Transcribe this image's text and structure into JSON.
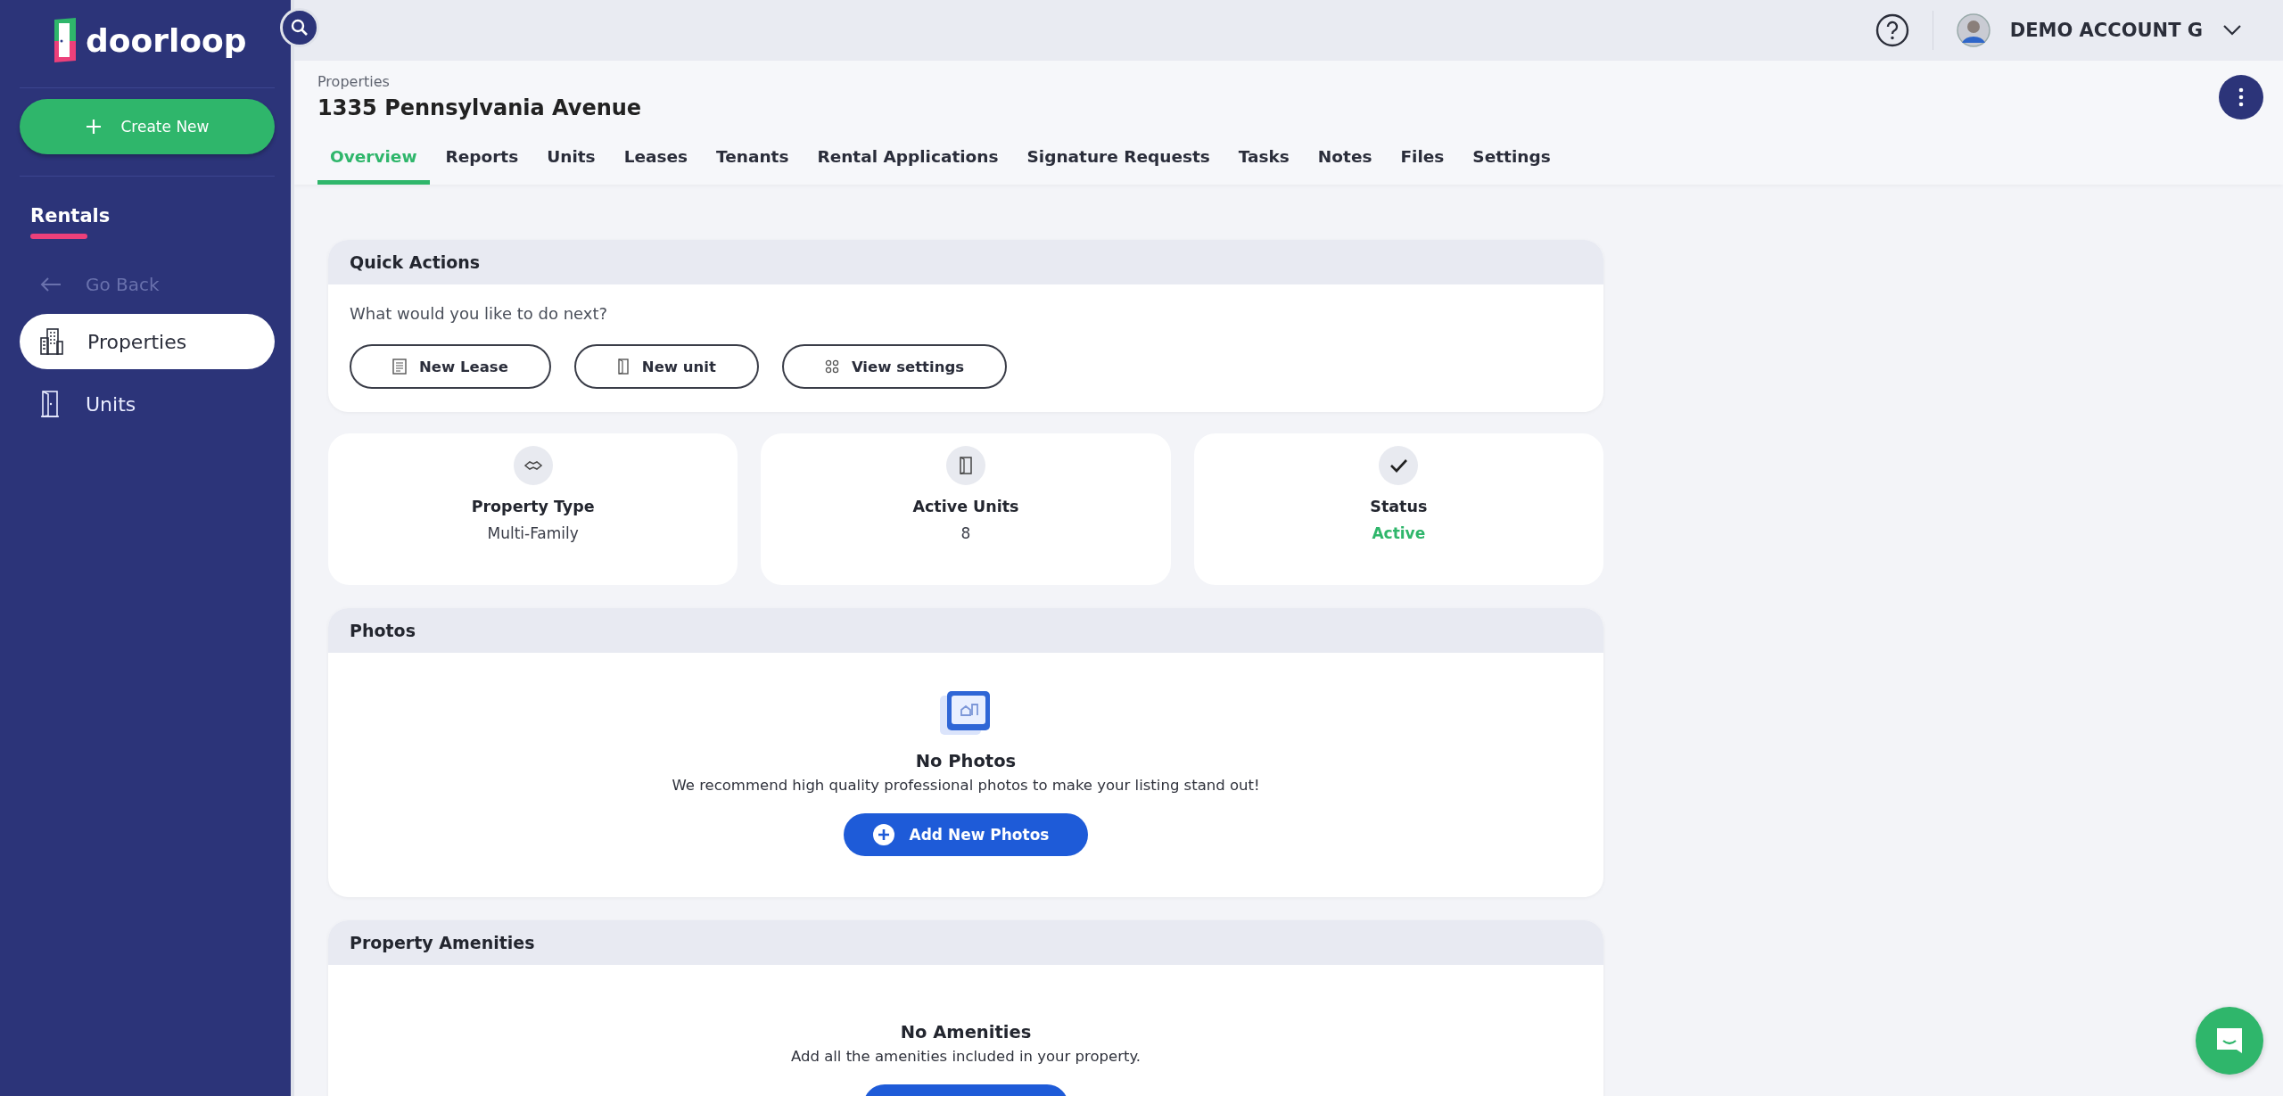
{
  "sidebar": {
    "logo": "doorloop",
    "create_button": "Create New",
    "section_title": "Rentals",
    "items": [
      {
        "label": "Go Back",
        "kind": "back",
        "selected": false,
        "disabled": true
      },
      {
        "label": "Properties",
        "kind": "properties",
        "selected": true,
        "disabled": false
      },
      {
        "label": "Units",
        "kind": "units",
        "selected": false,
        "disabled": false
      }
    ]
  },
  "topbar": {
    "account_name": "DEMO ACCOUNT G"
  },
  "header": {
    "breadcrumb": "Properties",
    "title": "1335 Pennsylvania Avenue",
    "tabs": [
      {
        "label": "Overview",
        "selected": true
      },
      {
        "label": "Reports",
        "selected": false
      },
      {
        "label": "Units",
        "selected": false
      },
      {
        "label": "Leases",
        "selected": false
      },
      {
        "label": "Tenants",
        "selected": false
      },
      {
        "label": "Rental Applications",
        "selected": false
      },
      {
        "label": "Signature Requests",
        "selected": false
      },
      {
        "label": "Tasks",
        "selected": false
      },
      {
        "label": "Notes",
        "selected": false
      },
      {
        "label": "Files",
        "selected": false
      },
      {
        "label": "Settings",
        "selected": false
      }
    ]
  },
  "quick_actions": {
    "title": "Quick Actions",
    "prompt": "What would you like to do next?",
    "buttons": [
      {
        "label": "New Lease",
        "kind": "lease"
      },
      {
        "label": "New unit",
        "kind": "unit"
      },
      {
        "label": "View settings",
        "kind": "settings"
      }
    ]
  },
  "stats": [
    {
      "label": "Property Type",
      "value": "Multi-Family",
      "kind": "type"
    },
    {
      "label": "Active Units",
      "value": "8",
      "kind": "units"
    },
    {
      "label": "Status",
      "value": "Active",
      "kind": "status"
    }
  ],
  "photos": {
    "title": "Photos",
    "empty_title": "No Photos",
    "empty_text": "We recommend high quality professional photos to make your listing stand out!",
    "button": "Add New Photos"
  },
  "amenities": {
    "title": "Property Amenities",
    "empty_title": "No Amenities",
    "empty_text": "Add all the amenities included in your property."
  }
}
